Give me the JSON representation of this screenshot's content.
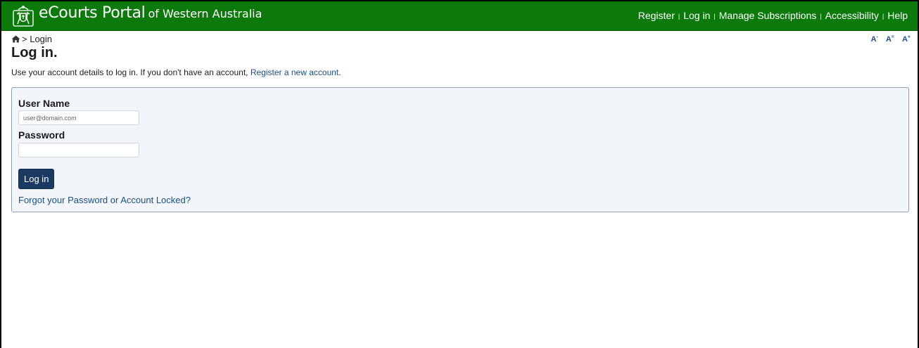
{
  "header": {
    "brand_main": "eCourts Portal",
    "brand_sub": "of Western Australia",
    "nav": [
      {
        "label": "Register"
      },
      {
        "label": "Log in"
      },
      {
        "label": "Manage Subscriptions"
      },
      {
        "label": "Accessibility"
      },
      {
        "label": "Help"
      }
    ],
    "separator": "|",
    "colors": {
      "bar": "#0b7a0b",
      "text": "#ffffff"
    }
  },
  "breadcrumb": {
    "home_icon": "home-icon",
    "separator": ">",
    "current": "Login"
  },
  "font_sizer": {
    "decrease": {
      "base": "A",
      "mark": "-"
    },
    "reset": {
      "base": "A",
      "mark": "="
    },
    "increase": {
      "base": "A",
      "mark": "+"
    }
  },
  "page": {
    "title": "Log in.",
    "intro_text": "Use your account details to log in. If you don't have an account,",
    "register_link": "Register a new account",
    "intro_end": "."
  },
  "form": {
    "username_label": "User Name",
    "username_placeholder": "user@domain.com",
    "username_value": "",
    "password_label": "Password",
    "password_value": "",
    "submit_label": "Log in",
    "forgot_link": "Forgot your Password or Account Locked?"
  },
  "colors": {
    "link": "#1a4f8b",
    "button": "#1b3a63",
    "panel_bg": "#f2f6fb",
    "panel_border": "#8aa0b8"
  }
}
